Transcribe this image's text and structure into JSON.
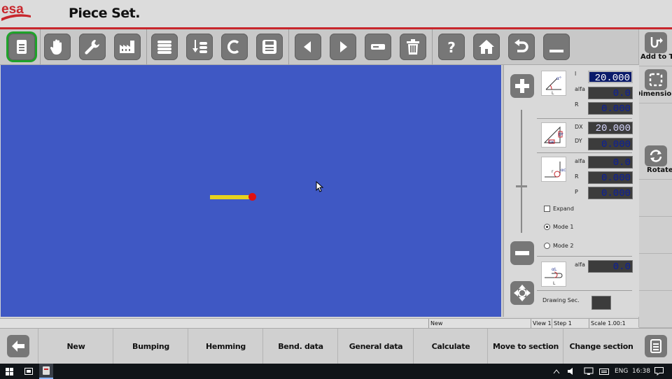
{
  "header": {
    "logo_text": "esa",
    "title": "Piece Set."
  },
  "toolbar": {
    "buttons": [
      "document-icon",
      "hand-icon",
      "wrench-icon",
      "factory-icon",
      "database-icon",
      "database-arrow-icon",
      "c-icon",
      "save-icon",
      "arrow-left-icon",
      "arrow-right-icon",
      "minus-box-icon",
      "trash-icon",
      "help-icon",
      "home-icon",
      "undo-icon",
      "minimize-icon"
    ]
  },
  "right_column": {
    "add_to_tail": "Add to Tail",
    "dimensioning": "Dimensioning",
    "rotate": "Rotate"
  },
  "panel": {
    "section1": {
      "label_l": "l",
      "label_alfa": "alfa",
      "label_r": "R",
      "value_l": "20.000",
      "value_alfa": "0.0",
      "value_r": "0.000"
    },
    "section2": {
      "label_dx": "DX",
      "label_dy": "DY",
      "value_dx": "20.000",
      "value_dy": "0.000"
    },
    "section3": {
      "label_alfa": "alfa",
      "label_r": "R",
      "label_p": "P",
      "value_alfa": "0.0",
      "value_r": "0.000",
      "value_p": "0.000"
    },
    "expand_label": "Expand",
    "mode1_label": "Mode 1",
    "mode2_label": "Mode 2",
    "selected_mode": "Mode 1",
    "section4": {
      "label_alfa": "alfa",
      "value_alfa": "0.0"
    },
    "drawing_sec_label": "Drawing Sec."
  },
  "status_bar": {
    "state": "New",
    "view": "View 1",
    "step": "Step 1",
    "scale": "Scale 1.00:1"
  },
  "bottom_bar": {
    "new": "New",
    "bumping": "Bumping",
    "hemming": "Hemming",
    "bend_data": "Bend. data",
    "general_data": "General data",
    "calculate": "Calculate",
    "move_to_section": "Move to section",
    "change_section": "Change section"
  },
  "taskbar": {
    "language": "ENG",
    "time": "16:38"
  },
  "colors": {
    "canvas": "#3f58c4",
    "accent_red": "#c8262c",
    "selected_green": "#1fa32a",
    "piece": "#e6d21e",
    "piece_end": "#e01010"
  }
}
